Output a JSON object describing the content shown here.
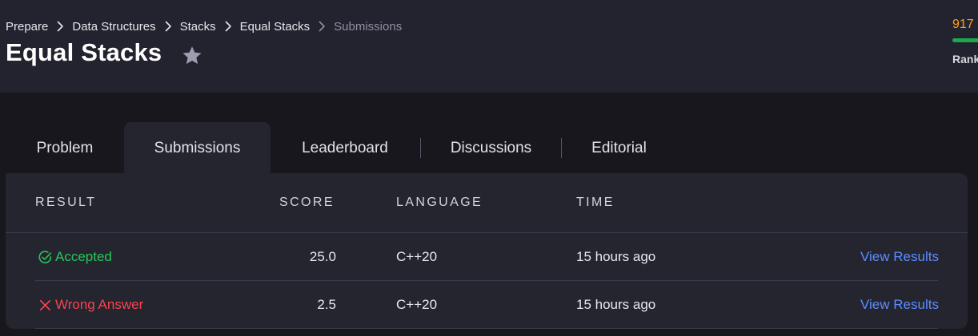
{
  "breadcrumb": {
    "items": [
      "Prepare",
      "Data Structures",
      "Stacks",
      "Equal Stacks"
    ],
    "current": "Submissions"
  },
  "page": {
    "title": "Equal Stacks"
  },
  "rank": {
    "score": "917",
    "label": "Rank"
  },
  "tabs": [
    "Problem",
    "Submissions",
    "Leaderboard",
    "Discussions",
    "Editorial"
  ],
  "table": {
    "headers": {
      "result": "RESULT",
      "score": "SCORE",
      "language": "LANGUAGE",
      "time": "TIME"
    },
    "rows": [
      {
        "result": "Accepted",
        "status": "accepted",
        "score": "25.0",
        "language": "C++20",
        "time": "15 hours ago",
        "action": "View Results"
      },
      {
        "result": "Wrong Answer",
        "status": "wrong",
        "score": "2.5",
        "language": "C++20",
        "time": "15 hours ago",
        "action": "View Results"
      }
    ]
  },
  "colors": {
    "accepted": "#26c75a",
    "wrong": "#f5444f",
    "link": "#5a8dff",
    "rank_score": "#ffa116",
    "progress": "#1ba94c"
  },
  "icons": {
    "star": "star-icon",
    "chevron": "chevron-right-icon",
    "accepted": "check-circle-icon",
    "wrong": "close-icon"
  }
}
